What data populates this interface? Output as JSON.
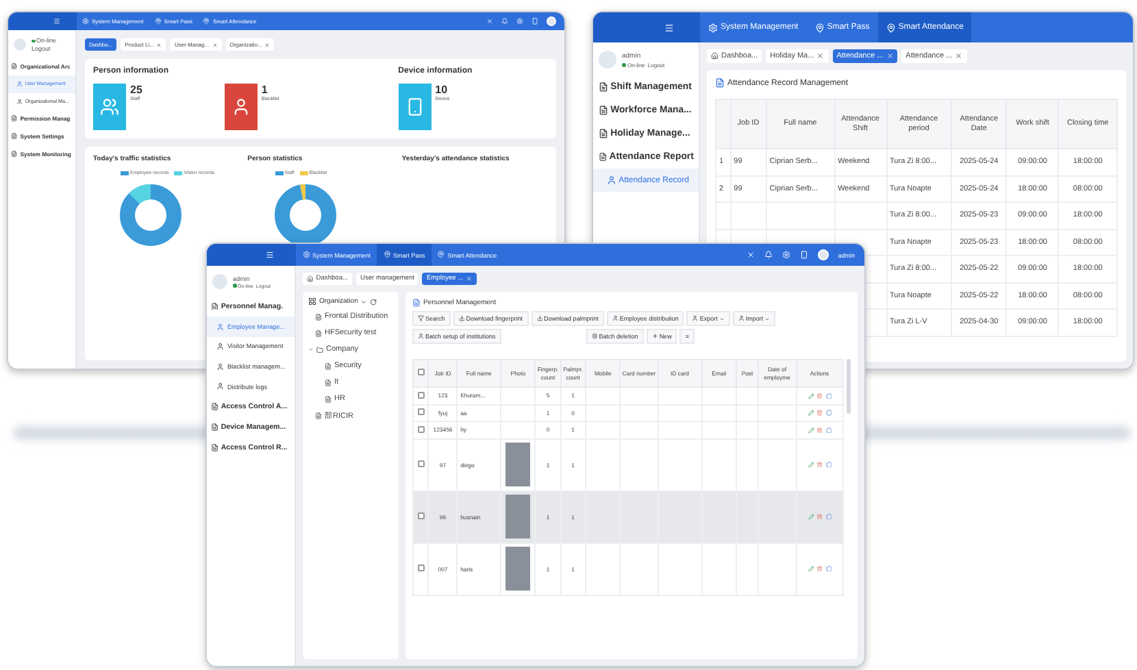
{
  "dashboard_window": {
    "nav": [
      {
        "label": "System Management",
        "selected": false
      },
      {
        "label": "Smart Pass",
        "selected": false
      },
      {
        "label": "Smart Attendance",
        "selected": false
      }
    ],
    "user": {
      "status": "On-line",
      "logout": "Logout"
    },
    "sidebar": [
      {
        "label": "Organizational Arc",
        "kind": "group",
        "selected": false
      },
      {
        "label": "User Management",
        "kind": "item",
        "selected": true
      },
      {
        "label": "Organizational Ma...",
        "kind": "item",
        "selected": false
      },
      {
        "label": "Permission Manag",
        "kind": "group",
        "selected": false
      },
      {
        "label": "System Settings",
        "kind": "group",
        "selected": false
      },
      {
        "label": "System Monitoring",
        "kind": "group",
        "selected": false
      }
    ],
    "tabs": [
      {
        "label": "Dashbo...",
        "selected": true
      },
      {
        "label": "Product Li...",
        "selected": false
      },
      {
        "label": "User Manag...",
        "selected": false
      },
      {
        "label": "Organizatio...",
        "selected": false
      }
    ],
    "person_info": {
      "title": "Person information",
      "cards": [
        {
          "kind": "staff",
          "value": "25",
          "label": "Staff",
          "color": "#29b8e3"
        },
        {
          "kind": "blacklist",
          "value": "1",
          "label": "Blacklist",
          "color": "#d9463b"
        }
      ]
    },
    "device_info": {
      "title": "Device information",
      "cards": [
        {
          "kind": "device",
          "value": "10",
          "label": "Device",
          "color": "#29b8e3"
        }
      ]
    },
    "stats": [
      {
        "title": "Today's traffic statistics",
        "legend": [
          {
            "label": "Employee records",
            "color": "#3a9bd8"
          },
          {
            "label": "Visitor records",
            "color": "#56d3e0"
          }
        ]
      },
      {
        "title": "Person statistics",
        "legend": [
          {
            "label": "Staff",
            "color": "#3a9bd8"
          },
          {
            "label": "Blacklist",
            "color": "#f2c94c"
          }
        ]
      },
      {
        "title": "Yesterday's attendance statistics"
      }
    ]
  },
  "attendance_window": {
    "nav": [
      {
        "label": "System Management",
        "selected": false
      },
      {
        "label": "Smart Pass",
        "selected": false
      },
      {
        "label": "Smart Attendance",
        "selected": true
      }
    ],
    "user": {
      "name": "admin",
      "status": "On-line",
      "logout": "Logout"
    },
    "sidebar": [
      {
        "label": "Shift Management",
        "kind": "group",
        "selected": false
      },
      {
        "label": "Workforce Mana...",
        "kind": "group",
        "selected": false
      },
      {
        "label": "Holiday Manage...",
        "kind": "group",
        "selected": false
      },
      {
        "label": "Attendance Report",
        "kind": "group",
        "selected": false
      },
      {
        "label": "Attendance Record",
        "kind": "item",
        "selected": true
      }
    ],
    "tabs": [
      {
        "label": "Dashboa...",
        "selected": false
      },
      {
        "label": "Holiday Ma...",
        "selected": false
      },
      {
        "label": "Attendance ...",
        "selected": true
      },
      {
        "label": "Attendance ...",
        "selected": false
      }
    ],
    "panel_title": "Attendance Record Management",
    "table": {
      "columns": [
        "Job ID",
        "Full name",
        "Attendance Shift",
        "Attendance period",
        "Attendance Date",
        "Work shift",
        "Closing time"
      ],
      "rows": [
        {
          "index": "1",
          "cells": [
            "99",
            "Ciprian Serb...",
            "Weekend",
            "Tura Zi 8:00...",
            "2025-05-24",
            "09:00:00",
            "18:00:00"
          ]
        },
        {
          "index": "2",
          "cells": [
            "99",
            "Ciprian Serb...",
            "Weekend",
            "Tura Noapte",
            "2025-05-24",
            "18:00:00",
            "08:00:00"
          ]
        },
        {
          "cells": [
            null,
            null,
            null,
            "Tura Zi 8:00...",
            "2025-05-23",
            "09:00:00",
            "18:00:00"
          ]
        },
        {
          "cells": [
            null,
            null,
            null,
            "Tura Noapte",
            "2025-05-23",
            "18:00:00",
            "08:00:00"
          ]
        },
        {
          "cells": [
            null,
            null,
            null,
            "Tura Zi 8:00...",
            "2025-05-22",
            "09:00:00",
            "18:00:00"
          ]
        },
        {
          "cells": [
            null,
            null,
            null,
            "Tura Noapte",
            "2025-05-22",
            "18:00:00",
            "08:00:00"
          ]
        },
        {
          "cells": [
            null,
            null,
            null,
            "Tura Zi L-V",
            "2025-04-30",
            "09:00:00",
            "18:00:00"
          ]
        }
      ]
    }
  },
  "personnel_window": {
    "nav": [
      {
        "label": "System Management",
        "selected": false
      },
      {
        "label": "Smart Pass",
        "selected": true
      },
      {
        "label": "Smart Attendance",
        "selected": false
      }
    ],
    "header_user": "admin",
    "user": {
      "name": "admin",
      "status": "On-line",
      "logout": "Logout"
    },
    "sidebar": [
      {
        "label": "Personnel Manag.",
        "kind": "group",
        "selected": false
      },
      {
        "label": "Employee Manage...",
        "kind": "item",
        "selected": true
      },
      {
        "label": "Visitor Management",
        "kind": "item",
        "selected": false
      },
      {
        "label": "Blacklist managem...",
        "kind": "item",
        "selected": false
      },
      {
        "label": "Distribute logs",
        "kind": "item",
        "selected": false
      },
      {
        "label": "Access Control A...",
        "kind": "group",
        "selected": false
      },
      {
        "label": "Device Managem...",
        "kind": "group",
        "selected": false
      },
      {
        "label": "Access Control R...",
        "kind": "group",
        "selected": false
      }
    ],
    "tabs": [
      {
        "label": "Dashboa...",
        "selected": false
      },
      {
        "label": "User management",
        "selected": false
      },
      {
        "label": "Employee ...",
        "selected": true
      }
    ],
    "organization": {
      "title": "Organization",
      "tree": [
        {
          "label": "Frontal Distribution"
        },
        {
          "label": "HFSecurity test"
        },
        {
          "label": "Company",
          "expanded": true,
          "children": [
            {
              "label": "Security"
            },
            {
              "label": "It"
            },
            {
              "label": "HR"
            }
          ]
        },
        {
          "label": "部RICIR"
        }
      ]
    },
    "panel_title": "Personnel Management",
    "toolbar": [
      {
        "kind": "search",
        "label": "Search"
      },
      {
        "kind": "download",
        "label": "Download fingerprint"
      },
      {
        "kind": "download",
        "label": "Download palmprint"
      },
      {
        "kind": "user",
        "label": "Employee distribution"
      },
      {
        "kind": "menu",
        "label": "Export"
      },
      {
        "kind": "menu",
        "label": "Import"
      },
      {
        "kind": "user",
        "label": "Batch setup of institutions"
      },
      {
        "kind": "delete",
        "label": "Batch deletion"
      },
      {
        "kind": "add",
        "label": "New"
      },
      {
        "kind": "more",
        "label": "≡"
      }
    ],
    "table": {
      "all_checked": false,
      "columns": [
        "Job ID",
        "Full name",
        "Photo",
        "Fingerp. count",
        "Palmpr. count",
        "Mobile",
        "Card number",
        "ID card",
        "Email",
        "Post",
        "Date of employme",
        "Actions"
      ],
      "rows": [
        {
          "checked": false,
          "selected": false,
          "photo": false,
          "job_id": "123",
          "name": "Khuram...",
          "fingerprints": "5",
          "palmprints": "1"
        },
        {
          "checked": false,
          "selected": false,
          "photo": false,
          "job_id": "fyuj",
          "name": "aa",
          "fingerprints": "1",
          "palmprints": "0"
        },
        {
          "checked": false,
          "selected": false,
          "photo": false,
          "job_id": "123456",
          "name": "hy",
          "fingerprints": "0",
          "palmprints": "1"
        },
        {
          "checked": false,
          "selected": false,
          "photo": true,
          "job_id": "97",
          "name": "diego",
          "fingerprints": "1",
          "palmprints": "1"
        },
        {
          "checked": false,
          "selected": true,
          "photo": true,
          "job_id": "96",
          "name": "husnain",
          "fingerprints": "1",
          "palmprints": "1"
        },
        {
          "checked": false,
          "selected": false,
          "photo": true,
          "job_id": "007",
          "name": "haris",
          "fingerprints": "1",
          "palmprints": "1"
        }
      ]
    }
  }
}
